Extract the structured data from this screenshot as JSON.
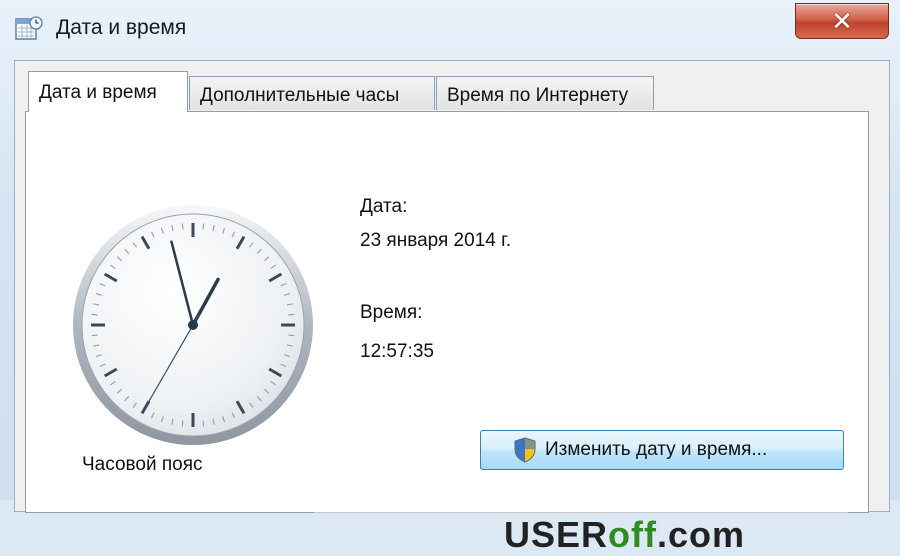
{
  "window": {
    "title": "Дата и время"
  },
  "tabs": [
    {
      "label": "Дата и время",
      "active": true
    },
    {
      "label": "Дополнительные часы",
      "active": false
    },
    {
      "label": "Время по Интернету",
      "active": false
    }
  ],
  "date_section": {
    "label": "Дата:",
    "value": "23 января 2014 г."
  },
  "time_section": {
    "label": "Время:",
    "value": "12:57:35"
  },
  "clock": {
    "hours": 12,
    "minutes": 57,
    "seconds": 35
  },
  "change_button": {
    "label": "Изменить дату и время...",
    "icon": "uac-shield-icon"
  },
  "timezone_section": {
    "label": "Часовой пояс"
  },
  "watermark": {
    "part1": "USER",
    "part2": "off",
    "part3": ".com"
  },
  "colors": {
    "close_button": "#c0442c",
    "button_border": "#3c7fb1",
    "watermark_green": "#2f8c1f"
  }
}
